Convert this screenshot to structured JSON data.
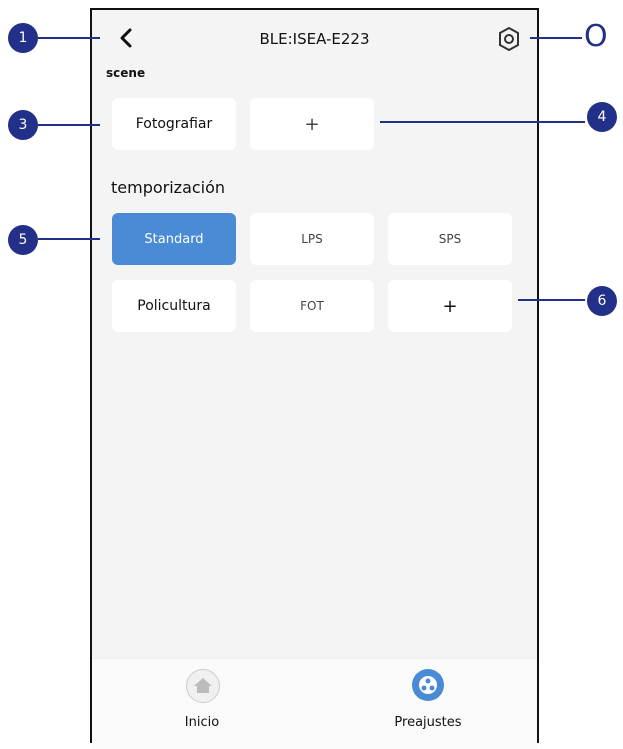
{
  "header": {
    "back_icon": "chevron-left-icon",
    "title": "BLE:ISEA-E223",
    "settings_icon": "gear-icon"
  },
  "scene": {
    "label": "scene",
    "items": [
      "Fotografiar"
    ],
    "add": "+"
  },
  "timer": {
    "label": "temporización",
    "row1": [
      "Standard",
      "LPS",
      "SPS"
    ],
    "row2": [
      "Policultura",
      "FOT"
    ],
    "add": "+",
    "active": "Standard",
    "accent": "#4a8bd6"
  },
  "nav": {
    "home": "Inicio",
    "presets": "Preajustes"
  },
  "callouts": {
    "c1": "1",
    "c0": "O",
    "c3": "3",
    "c4": "4",
    "c5": "5",
    "c6": "6",
    "color": "#23308a"
  }
}
